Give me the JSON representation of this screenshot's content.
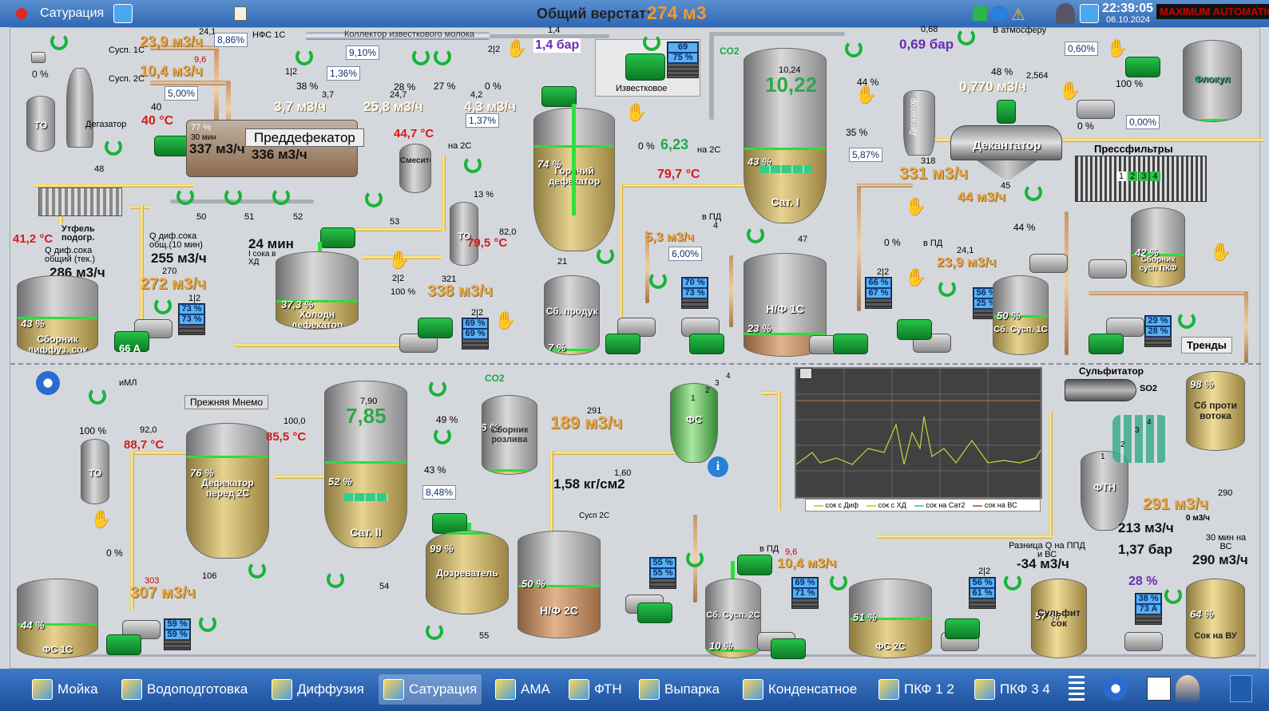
{
  "window": {
    "title": "Сатурация",
    "center_label": "Общий верстат:",
    "center_value": "274 м3",
    "time": "22:39:05",
    "date": "06.10.2024",
    "brand": "MAXIMUM AUTOMATION"
  },
  "labels": {
    "flow1": "23,9 м3/ч",
    "flow1_top": "24,1",
    "susp1c": "Сусп. 1С",
    "pct886": "8,86%",
    "nfs1c": "НФС 1С",
    "flow2": "10,4 м3/ч",
    "flow2_top": "9,6",
    "susp2c": "Сусп. 2С",
    "pct5": "5,00%",
    "collector": "Коллектор известкового молока",
    "pct910": "9,10%",
    "pct136": "1,36%",
    "p14": "1,4",
    "bar14": "1,4 бар",
    "degas": "Дегазатор",
    "temp40top": "40",
    "temp40": "40 °С",
    "to": "ТО",
    "v48": "48",
    "flow37": "3,7 м3/ч",
    "flow37top": "3,7",
    "flow258": "25,8 м3/ч",
    "flow258top": "24,7",
    "flow43": "4,3 м3/ч",
    "flow43top": "4,2",
    "pct137": "1,37%",
    "na2c": "на 2С",
    "predef": "Преддефекатор",
    "pred_pct": "77 %",
    "pred_time": "30 мин",
    "pred337": "337 м3/ч",
    "pred336": "336 м3/ч",
    "temp447": "44,7 °С",
    "smes": "Смеситель",
    "v0": "0 %",
    "v38": "38 %",
    "v28": "28 %",
    "v27": "27 %",
    "v1_2": "1|2",
    "v2_2": "2|2",
    "v50": "50",
    "v51": "51",
    "v52": "52",
    "v53": "53",
    "temp412": "41,2 °С",
    "utfel": "Утфель подогр.",
    "qdif": "Q диф.сока общ.(10 мин)",
    "qdif_tek": "Q диф.сока общий (тек.)",
    "f255": "255 м3/ч",
    "f286": "286 м3/ч",
    "t24": "24 мин",
    "t24sub": "I сока в ХД",
    "sbdif": "Сборник диффуз. сок",
    "sbdif_pct": "43 %",
    "f272": "272 м3/ч",
    "f270": "270",
    "v1_2b": "1|2",
    "d7373a": "73 %",
    "d7373b": "73 %",
    "a66": "66 A",
    "hold": "Холодн дефекатор",
    "hold_pct": "37,3 %",
    "to2": "ТО",
    "temp795": "79,5 °С",
    "t820": "82,0",
    "f338": "338 м3/ч",
    "f321": "321",
    "v100": "100 %",
    "v13": "13 %",
    "d69a": "69 %",
    "d69b": "69 %",
    "v2_2b": "2|2",
    "izv": "Известковое",
    "izv_pct": "69",
    "izv_pct2": "75 %",
    "hot": "Горячий дефекатор",
    "hot_pct": "74 %",
    "sbprod": "Сб. продук",
    "sbprod_pct": "7 %",
    "v21": "21",
    "co2": "CO2",
    "sat1_top": "10,24",
    "sat1": "10,22",
    "sat1_pct": "43 %",
    "sat1_name": "Сат. I",
    "f623": "6,23",
    "na2c_b": "на 2С",
    "temp797": "79,7 °С",
    "v47": "47",
    "f53": "5,3 м3/ч",
    "v6": "6,00%",
    "vpd": "в ПД",
    "v4": "4",
    "nf1c": "Н/Ф 1С",
    "nf1c_pct": "23 %",
    "d7073a": "70 %",
    "d7073b": "73 %",
    "p068top": "0,68",
    "p069": "0,69 бар",
    "atm": "В атмосферу",
    "v44": "44 %",
    "v35": "35 %",
    "v587": "5,87%",
    "v48b": "48 %",
    "p2564": "2,564",
    "p0770": "0,770 м3/ч",
    "degas2": "Дегазатор",
    "dek": "Декантатор",
    "f331": "331 м3/ч",
    "f318": "318",
    "f44": "44 м3/ч",
    "f45": "45",
    "v44b": "44 %",
    "v0c": "0 %",
    "vpd2": "в ПД",
    "f239": "23,9 м3/ч",
    "f241": "24,1",
    "d6667a": "66 %",
    "d6667b": "67 %",
    "v2_2c": "2|2",
    "sbsusp": "Сб. Сусп. 1С",
    "sbsusp_pct": "50 %",
    "d5625a": "56 %",
    "d5625b": "25 %",
    "pct060": "0,60%",
    "v100b": "100 %",
    "v0d": "0 %",
    "pct000": "0,00%",
    "flok": "Флокул",
    "press": "Прессфильтры",
    "pf1": "1",
    "pf2": "2",
    "pf3": "3",
    "pf4": "4",
    "sbpkf": "Сборник сусп ПКФ",
    "sbpkf_pct": "42 %",
    "d2928a": "29 %",
    "d2928b": "28 %",
    "trends": "Тренды",
    "iml": "иМЛ",
    "v100c": "100 %",
    "t920": "92,0",
    "temp887": "88,7 °С",
    "to3": "ТО",
    "v0e": "0 %",
    "prev": "Прежняя Мнемо",
    "def2": "Дефекатор перед 2С",
    "def2_pct": "76 %",
    "t1000": "100,0",
    "temp855": "85,5 °С",
    "v106": "106",
    "f307": "307 м3/ч",
    "f303": "303",
    "d5959a": "59 %",
    "d5959b": "59 %",
    "fs1c": "ФС 1С",
    "fs1c_pct": "44 %",
    "sat2_top": "7,90",
    "sat2": "7,85",
    "sat2_pct": "52 %",
    "sat2_name": "Сат. II",
    "v49": "49 %",
    "v43": "43 %",
    "v848": "8,48%",
    "co2b": "CO2",
    "v54": "54",
    "v55": "55",
    "sbr": "Сборник розлива",
    "sbr_pct": "6 %",
    "dozr": "Дозреватель",
    "dozr_pct": "99 %",
    "nf2c": "Н/Ф 2С",
    "nf2c_pct": "50 %",
    "susp2c_b": "Сусп 2С",
    "f189": "189 м3/ч",
    "f291": "291",
    "p158": "1,58 кг/см2",
    "p160": "1,60",
    "fs": "ФС",
    "fs1": "1",
    "fs2": "2",
    "fs3": "3",
    "fs4": "4",
    "d5555a": "55 %",
    "d5555b": "55 %",
    "sbs2c": "Сб. Сусп. 2С",
    "sbs2c_pct": "10 %",
    "vpd3": "в ПД",
    "f104": "10,4 м3/ч",
    "f96": "9,6",
    "d6971a": "69 %",
    "d6971b": "71 %",
    "fs2c": "ФС 2С",
    "fs2c_pct": "51 %",
    "d5661a": "56 %",
    "d5661b": "61 %",
    "v2_2d": "2|2",
    "sulf": "Сульфитатор",
    "so2": "SO2",
    "sbprot": "Сб проти вотока",
    "sbprot_pct": "98 %",
    "ftn": "ФТН",
    "f291b": "291 м3/ч",
    "f290top": "290",
    "f213": "213 м3/ч",
    "p137": "1,37 бар",
    "p0m": "0 м3/ч",
    "raz": "Разница Q на ППД и ВС",
    "raz_val": "-34 м3/ч",
    "t30": "30 мин на ВС",
    "f290": "290 м3/ч",
    "sulfsok": "Сульфит сок",
    "sulfsok_pct": "57 %",
    "pct28": "28 %",
    "d3873a": "38 %",
    "d3873b": "73 A",
    "sokvu": "Сок на ВУ",
    "sokvu_pct": "64 %"
  },
  "trend": {
    "legend": [
      "сок с Диф",
      "сок с ХД",
      "сок на Сат2",
      "сок на ВС"
    ],
    "colors": [
      "#c8d63a",
      "#e0d040",
      "#5ad0d0",
      "#c07a50"
    ]
  },
  "taskbar": [
    {
      "label": "Мойка"
    },
    {
      "label": "Водоподготовка"
    },
    {
      "label": "Диффузия"
    },
    {
      "label": "Сатурация",
      "active": true
    },
    {
      "label": "АМА"
    },
    {
      "label": "ФТН"
    },
    {
      "label": "Выпарка"
    },
    {
      "label": "Конденсатное"
    },
    {
      "label": "ПКФ 1 2"
    },
    {
      "label": "ПКФ 3 4"
    }
  ]
}
